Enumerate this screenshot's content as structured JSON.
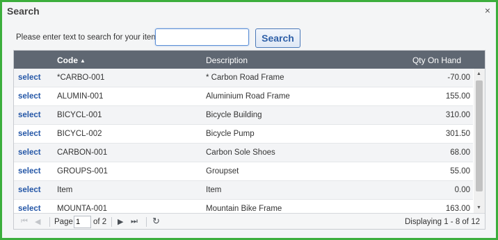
{
  "dialog": {
    "title": "Search",
    "close_glyph": "×"
  },
  "search": {
    "label": "Please enter text to search for your item:",
    "value": "",
    "placeholder": "",
    "button_label": "Search"
  },
  "grid": {
    "columns": {
      "code": "Code",
      "code_sort_glyph": "▲",
      "description": "Description",
      "qty": "Qty On Hand"
    },
    "rows": [
      {
        "action": "select",
        "code": "*CARBO-001",
        "description": "* Carbon Road Frame",
        "qty": "-70.00"
      },
      {
        "action": "select",
        "code": "ALUMIN-001",
        "description": "Aluminium Road Frame",
        "qty": "155.00"
      },
      {
        "action": "select",
        "code": "BICYCL-001",
        "description": "Bicycle Building",
        "qty": "310.00"
      },
      {
        "action": "select",
        "code": "BICYCL-002",
        "description": "Bicycle Pump",
        "qty": "301.50"
      },
      {
        "action": "select",
        "code": "CARBON-001",
        "description": "Carbon Sole Shoes",
        "qty": "68.00"
      },
      {
        "action": "select",
        "code": "GROUPS-001",
        "description": "Groupset",
        "qty": "55.00"
      },
      {
        "action": "select",
        "code": "Item",
        "description": "Item",
        "qty": "0.00"
      },
      {
        "action": "select",
        "code": "MOUNTA-001",
        "description": "Mountain Bike Frame",
        "qty": "163.00"
      }
    ]
  },
  "pager": {
    "first_glyph": "⏮",
    "prev_glyph": "◀",
    "next_glyph": "▶",
    "last_glyph": "⏭",
    "refresh_glyph": "↻",
    "page_label": "Page",
    "page_value": "1",
    "of_label": "of 2",
    "displaying": "Displaying 1 - 8 of 12"
  }
}
